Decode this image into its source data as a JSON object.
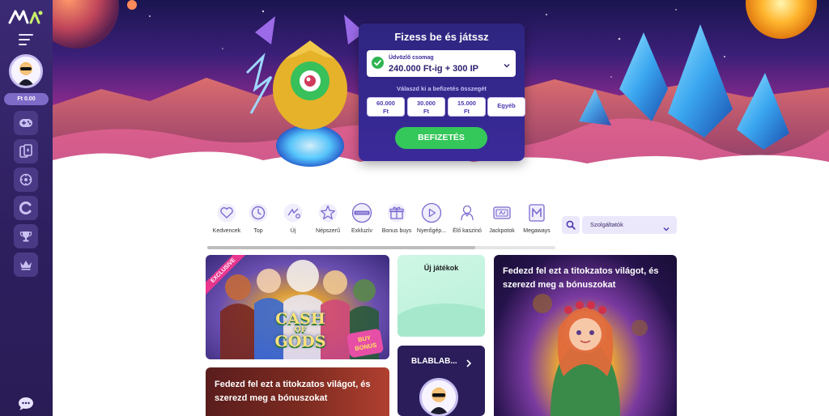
{
  "sidebar": {
    "logo_text": "AW",
    "balance": "Ft 0.00",
    "items": [
      {
        "icon": "gamepad-icon"
      },
      {
        "icon": "cards-icon"
      },
      {
        "icon": "roulette-icon"
      },
      {
        "icon": "live-icon"
      },
      {
        "icon": "trophy-icon"
      },
      {
        "icon": "crown-icon"
      }
    ],
    "chat_icon": "chat-icon"
  },
  "deposit": {
    "title": "Fizess be és játssz",
    "promo_label": "Üdvözlő csomag",
    "promo_value": "240.000 Ft-ig + 300 IP",
    "hint": "Válaszd ki a befizetés összegét",
    "amounts": [
      {
        "line1": "60.000",
        "line2": "Ft"
      },
      {
        "line1": "30.000",
        "line2": "Ft"
      },
      {
        "line1": "15.000",
        "line2": "Ft"
      }
    ],
    "other": "Egyéb",
    "button": "BEFIZETÉS"
  },
  "categories": [
    {
      "label": "Kedvencek",
      "icon": "heart-icon"
    },
    {
      "label": "Top",
      "icon": "top-icon"
    },
    {
      "label": "Új",
      "icon": "new-icon"
    },
    {
      "label": "Népszerű",
      "icon": "star-icon"
    },
    {
      "label": "Exkluzív",
      "icon": "exclusive-icon"
    },
    {
      "label": "Bonus buys",
      "icon": "gift-icon"
    },
    {
      "label": "Nyerőgép...",
      "icon": "slot-icon"
    },
    {
      "label": "Élő kaszinó",
      "icon": "dealer-icon"
    },
    {
      "label": "Jackpotok",
      "icon": "jackpot-icon"
    },
    {
      "label": "Megaways",
      "icon": "megaways-icon"
    }
  ],
  "category_scroll_fraction": 0.77,
  "providers": {
    "label": "Szolgáltatók"
  },
  "cards": {
    "gods": {
      "badge": "EXCLUSIVE",
      "title_line1": "CASH",
      "title_line2": "OF",
      "title_line3": "GODS",
      "bonus": "BUY BONUS"
    },
    "new_games": {
      "title": "Új játékok"
    },
    "blablab": {
      "title": "BLABLAB..."
    },
    "promo_left": {
      "text": "Fedezd fel ezt a titokzatos világot, és szerezd meg a bónuszokat"
    },
    "promo_right": {
      "text": "Fedezd fel ezt a titokzatos világot, és szerezd meg a bónuszokat"
    }
  },
  "colors": {
    "sidebar": "#2d1f5e",
    "accent": "#34c759",
    "deposit_panel": "#3a2a9a",
    "balance_pill": "#7e6bc8"
  }
}
